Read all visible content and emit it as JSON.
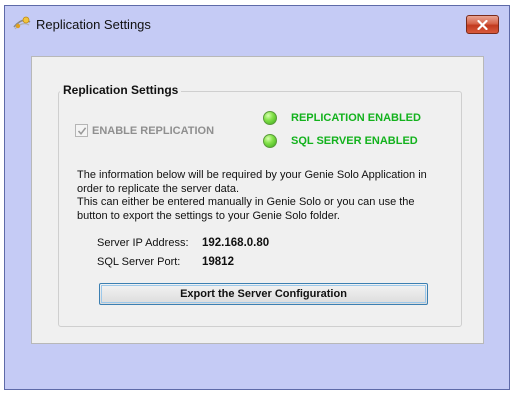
{
  "window": {
    "title": "Replication Settings",
    "icon": "replication-app-icon",
    "close_icon": "close-x-icon"
  },
  "group": {
    "legend": "Replication Settings"
  },
  "enable_replication": {
    "label": "ENABLE REPLICATION",
    "checked": true,
    "disabled": true
  },
  "status": [
    {
      "label": "REPLICATION ENABLED",
      "state": "on",
      "color": "#13b21d"
    },
    {
      "label": "SQL SERVER ENABLED",
      "state": "on",
      "color": "#13b21d"
    }
  ],
  "info": {
    "line1": "The information below will be required by your Genie Solo Application in order to replicate the server data.",
    "line2": "This can either be entered manually in Genie Solo or you can use the button to export the settings to your Genie Solo folder."
  },
  "fields": {
    "ip_label": "Server IP Address:",
    "ip_value": "192.168.0.80",
    "port_label": "SQL Server Port:",
    "port_value": "19812"
  },
  "export_button": {
    "label": "Export the Server Configuration"
  },
  "colors": {
    "frame": "#c5cbf5",
    "client": "#f0f0f0",
    "status_green": "#13b21d",
    "close_red": "#c23a1f"
  }
}
